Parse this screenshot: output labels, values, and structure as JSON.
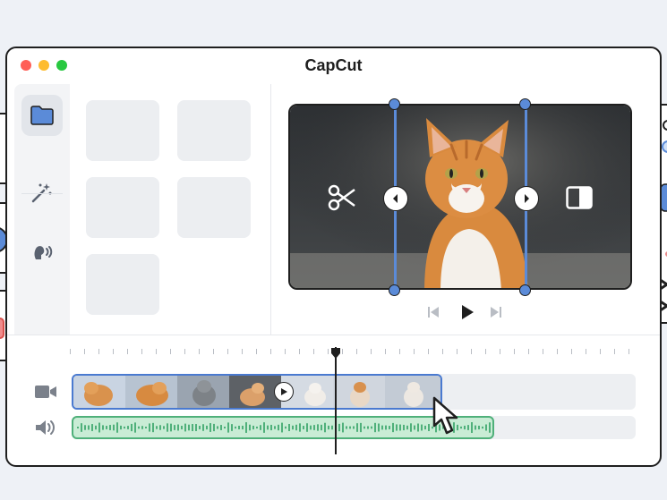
{
  "window": {
    "title": "CapCut"
  },
  "colors": {
    "accent": "#5b8bd8",
    "audio": "#4fb07a",
    "outline": "#1f1f1f"
  },
  "sidebar": {
    "items": [
      {
        "icon": "folder-icon",
        "active": true
      },
      {
        "icon": "magic-wand-icon",
        "active": false
      },
      {
        "icon": "audio-profile-icon",
        "active": false
      }
    ]
  },
  "preview": {
    "tools": [
      "scissors-icon",
      "split-screen-icon"
    ]
  },
  "playback": {
    "controls": [
      "skip-back-icon",
      "play-icon",
      "skip-forward-icon"
    ]
  },
  "timeline": {
    "tracks": [
      "video-track",
      "audio-track"
    ]
  }
}
